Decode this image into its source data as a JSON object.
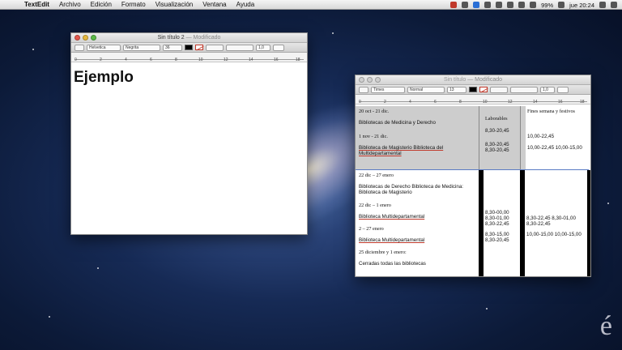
{
  "menubar": {
    "app": "TextEdit",
    "items": [
      "Archivo",
      "Edición",
      "Formato",
      "Visualización",
      "Ventana",
      "Ayuda"
    ],
    "battery": "99%",
    "clock": "jue 20:24"
  },
  "window1": {
    "title": "Sin título 2",
    "modified": "— Modificado",
    "font_family": "Helvetica",
    "font_style": "Negrita",
    "font_size": "36",
    "line_spacing": "1,0",
    "ruler_numbers": [
      "0",
      "2",
      "4",
      "6",
      "8",
      "10",
      "12",
      "14",
      "16",
      "18"
    ],
    "content_heading": "Ejemplo"
  },
  "window2": {
    "title": "Sin título",
    "modified": "— Modificado",
    "font_family": "Times",
    "font_style": "Normal",
    "font_size": "13",
    "line_spacing": "1,0",
    "ruler_numbers": [
      "0",
      "2",
      "4",
      "6",
      "8",
      "10",
      "12",
      "14",
      "16",
      "18"
    ],
    "table": {
      "header_col2": "Laborables",
      "header_col3": "Fines semana y festivos",
      "r1_period": "20 oct - 21 dic.",
      "r1_place": "Bibliotecas de Medicina y Derecho",
      "r1_lab": "8,30-20,45",
      "r2_period": "1 nov - 21 dic.",
      "r2_fest": "10,00-22,45",
      "r3_place": "Biblioteca de Magisterio Biblioteca del Multidepartamental",
      "r3_lab": "8,30-20,45 8,30-20,45",
      "r3_fest": "10,00-22,45 10,00-15,00",
      "r4_period": "22 dic – 27 enero",
      "r4_place": "Bibliotecas de Derecho Biblioteca de Medicina: Biblioteca de Magisterio",
      "r5_period": "22 dic – 1 enero",
      "r5_place": "Biblioteca Multidepartamental",
      "r5_lab": "8,30-00,00 8,30-01,00 8,30-22,45",
      "r5_fest": "8,30-22,45 8,30-01,00 8,30-22,45",
      "r6_period": "2 – 27 enero",
      "r6_place": "Biblioteca Multidepartamental",
      "r6_lab": "8,30-15,00 8,30-20,45",
      "r6_fest": "10,00-15,00 10,00-15,00",
      "r7_period": "25 diciembre y 1 enero:",
      "r7_place": "Cerradas todas las bibliotecas"
    }
  },
  "watermark": "é"
}
